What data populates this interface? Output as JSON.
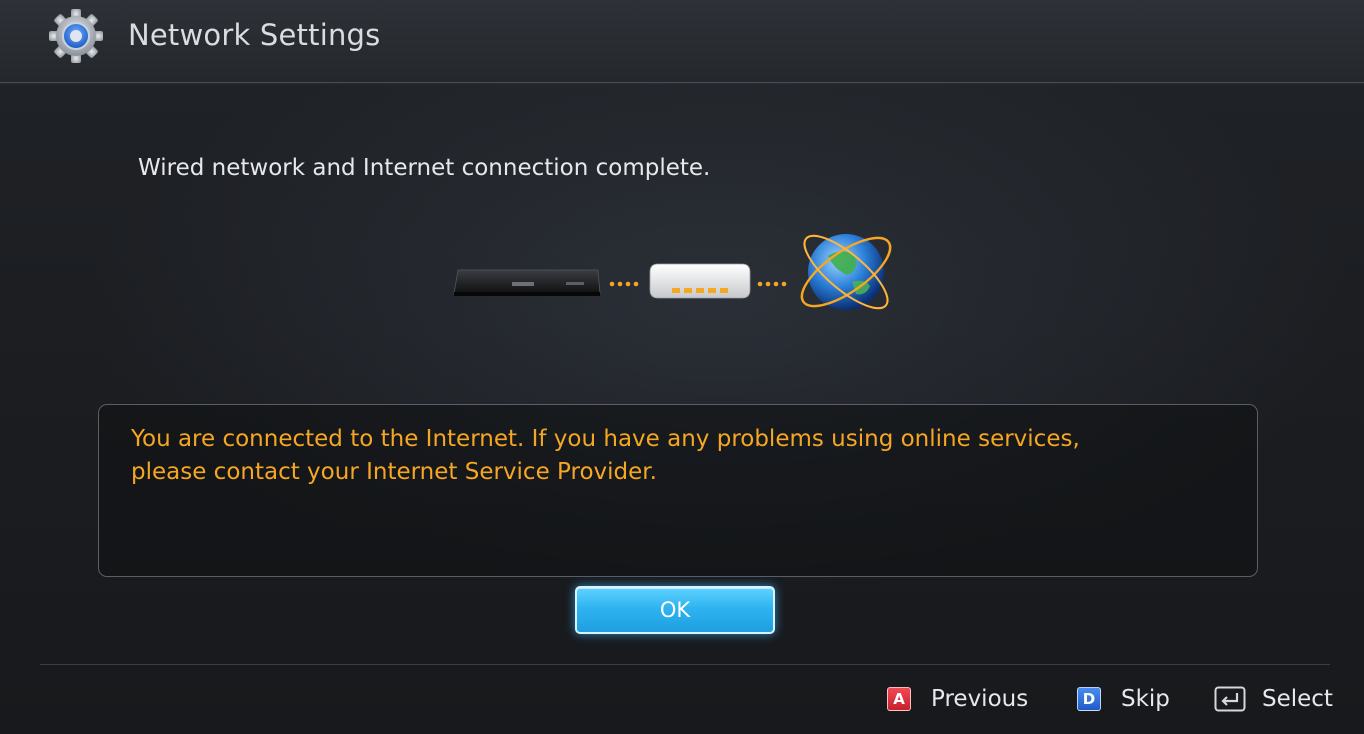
{
  "header": {
    "title": "Network Settings",
    "icon": "gear-icon"
  },
  "status": {
    "message": "Wired network and Internet connection complete."
  },
  "diagram": {
    "devices": [
      "tv-device-icon",
      "router-icon",
      "globe-icon"
    ]
  },
  "info_box": {
    "line1": "You are connected to the Internet. If you have any problems using online services,",
    "line2": "please contact your Internet Service Provider.",
    "text_color": "#f5a623"
  },
  "buttons": {
    "ok_label": "OK",
    "ok_color": "#2fb4f0"
  },
  "footer": {
    "previous": {
      "key": "A",
      "label": "Previous",
      "key_color": "#d62d39"
    },
    "skip": {
      "key": "D",
      "label": "Skip",
      "key_color": "#2f6fd8"
    },
    "select": {
      "label": "Select",
      "icon": "enter-key-icon"
    }
  }
}
